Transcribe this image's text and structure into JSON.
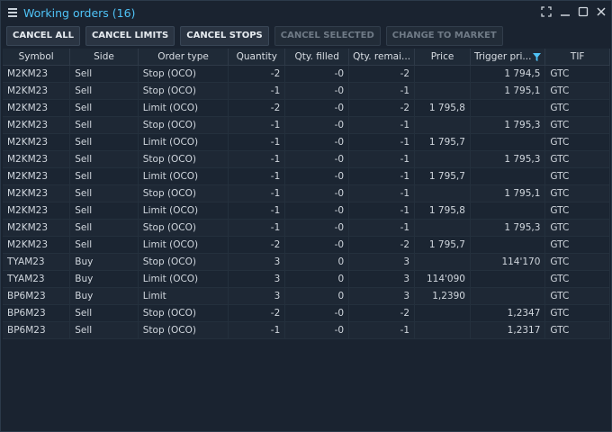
{
  "window": {
    "title": "Working orders (16)"
  },
  "toolbar": [
    {
      "label": "CANCEL ALL",
      "enabled": true
    },
    {
      "label": "CANCEL LIMITS",
      "enabled": true
    },
    {
      "label": "CANCEL STOPS",
      "enabled": true
    },
    {
      "label": "CANCEL SELECTED",
      "enabled": false
    },
    {
      "label": "CHANGE TO MARKET",
      "enabled": false
    }
  ],
  "columns": [
    "Symbol",
    "Side",
    "Order type",
    "Quantity",
    "Qty. filled",
    "Qty. remai...",
    "Price",
    "Trigger pri...",
    "TIF"
  ],
  "colors": {
    "sell": "#f0673a",
    "buy": "#3fd4a5",
    "accent": "#4fc3f7"
  },
  "orders": [
    {
      "symbol": "M2KM23",
      "side": "Sell",
      "type": "Stop (OCO)",
      "qty": "-2",
      "filled": "-0",
      "remaining": "-2",
      "price": "",
      "trigger": "1 794,5",
      "tif": "GTC"
    },
    {
      "symbol": "M2KM23",
      "side": "Sell",
      "type": "Stop (OCO)",
      "qty": "-1",
      "filled": "-0",
      "remaining": "-1",
      "price": "",
      "trigger": "1 795,1",
      "tif": "GTC"
    },
    {
      "symbol": "M2KM23",
      "side": "Sell",
      "type": "Limit (OCO)",
      "qty": "-2",
      "filled": "-0",
      "remaining": "-2",
      "price": "1 795,8",
      "trigger": "",
      "tif": "GTC"
    },
    {
      "symbol": "M2KM23",
      "side": "Sell",
      "type": "Stop (OCO)",
      "qty": "-1",
      "filled": "-0",
      "remaining": "-1",
      "price": "",
      "trigger": "1 795,3",
      "tif": "GTC"
    },
    {
      "symbol": "M2KM23",
      "side": "Sell",
      "type": "Limit (OCO)",
      "qty": "-1",
      "filled": "-0",
      "remaining": "-1",
      "price": "1 795,7",
      "trigger": "",
      "tif": "GTC"
    },
    {
      "symbol": "M2KM23",
      "side": "Sell",
      "type": "Stop (OCO)",
      "qty": "-1",
      "filled": "-0",
      "remaining": "-1",
      "price": "",
      "trigger": "1 795,3",
      "tif": "GTC"
    },
    {
      "symbol": "M2KM23",
      "side": "Sell",
      "type": "Limit (OCO)",
      "qty": "-1",
      "filled": "-0",
      "remaining": "-1",
      "price": "1 795,7",
      "trigger": "",
      "tif": "GTC"
    },
    {
      "symbol": "M2KM23",
      "side": "Sell",
      "type": "Stop (OCO)",
      "qty": "-1",
      "filled": "-0",
      "remaining": "-1",
      "price": "",
      "trigger": "1 795,1",
      "tif": "GTC"
    },
    {
      "symbol": "M2KM23",
      "side": "Sell",
      "type": "Limit (OCO)",
      "qty": "-1",
      "filled": "-0",
      "remaining": "-1",
      "price": "1 795,8",
      "trigger": "",
      "tif": "GTC"
    },
    {
      "symbol": "M2KM23",
      "side": "Sell",
      "type": "Stop (OCO)",
      "qty": "-1",
      "filled": "-0",
      "remaining": "-1",
      "price": "",
      "trigger": "1 795,3",
      "tif": "GTC"
    },
    {
      "symbol": "M2KM23",
      "side": "Sell",
      "type": "Limit (OCO)",
      "qty": "-2",
      "filled": "-0",
      "remaining": "-2",
      "price": "1 795,7",
      "trigger": "",
      "tif": "GTC"
    },
    {
      "symbol": "TYAM23",
      "side": "Buy",
      "type": "Stop (OCO)",
      "qty": "3",
      "filled": "0",
      "remaining": "3",
      "price": "",
      "trigger": "114'170",
      "tif": "GTC"
    },
    {
      "symbol": "TYAM23",
      "side": "Buy",
      "type": "Limit (OCO)",
      "qty": "3",
      "filled": "0",
      "remaining": "3",
      "price": "114'090",
      "trigger": "",
      "tif": "GTC"
    },
    {
      "symbol": "BP6M23",
      "side": "Buy",
      "type": "Limit",
      "qty": "3",
      "filled": "0",
      "remaining": "3",
      "price": "1,2390",
      "trigger": "",
      "tif": "GTC"
    },
    {
      "symbol": "BP6M23",
      "side": "Sell",
      "type": "Stop (OCO)",
      "qty": "-2",
      "filled": "-0",
      "remaining": "-2",
      "price": "",
      "trigger": "1,2347",
      "tif": "GTC"
    },
    {
      "symbol": "BP6M23",
      "side": "Sell",
      "type": "Stop (OCO)",
      "qty": "-1",
      "filled": "-0",
      "remaining": "-1",
      "price": "",
      "trigger": "1,2317",
      "tif": "GTC"
    }
  ]
}
